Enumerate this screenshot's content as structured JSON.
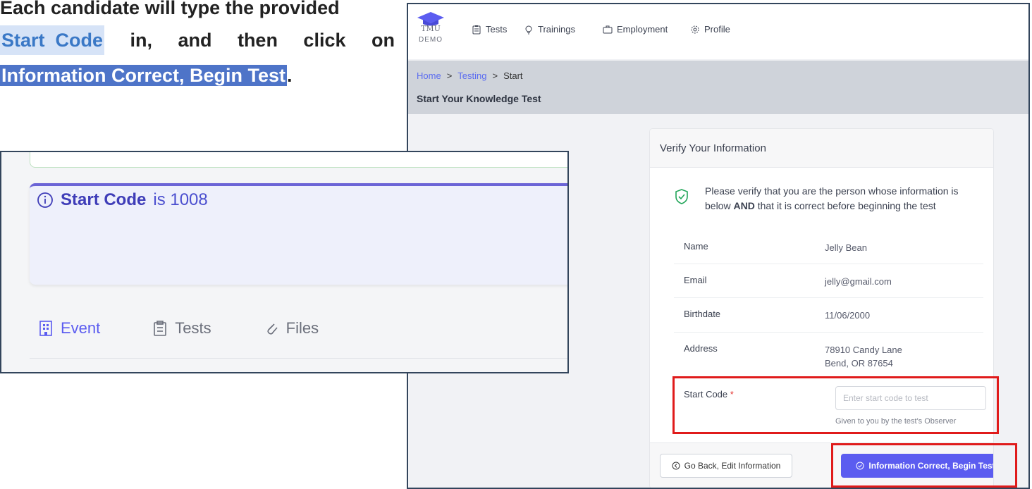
{
  "instruction": {
    "line1": "Each candidate will type the provided",
    "line2_word1": "Start",
    "line2_word2": "Code",
    "line2_mid1": "in,",
    "line2_mid2": "and",
    "line2_mid3": "then",
    "line2_mid4": "click",
    "line2_end": "on",
    "line3_highlight": "Information Correct, Begin Test",
    "line3_end": "."
  },
  "app": {
    "logo": {
      "tmu": "TMU",
      "demo": "DEMO"
    },
    "nav": [
      {
        "label": "Tests",
        "icon": "clipboard-icon"
      },
      {
        "label": "Trainings",
        "icon": "lightbulb-icon"
      },
      {
        "label": "Employment",
        "icon": "briefcase-icon"
      },
      {
        "label": "Profile",
        "icon": "gear-icon"
      }
    ],
    "breadcrumb": {
      "home": "Home",
      "testing": "Testing",
      "start": "Start",
      "separator": ">"
    },
    "page_title": "Start Your Knowledge Test",
    "card": {
      "title": "Verify Your Information",
      "notice_pre": "Please verify that you are the person whose information is below ",
      "notice_bold": "AND",
      "notice_post": " that it is correct before beginning the test",
      "rows": [
        {
          "label": "Name",
          "value": "Jelly Bean"
        },
        {
          "label": "Email",
          "value": "jelly@gmail.com"
        },
        {
          "label": "Birthdate",
          "value": "11/06/2000"
        },
        {
          "label": "Address",
          "value_line1": "78910 Candy Lane",
          "value_line2": "Bend, OR 87654"
        }
      ],
      "start_code": {
        "label": "Start Code",
        "required_mark": "*",
        "placeholder": "Enter start code to test",
        "value": "",
        "help": "Given to you by the test's Observer"
      },
      "back_button": "Go Back, Edit Information",
      "submit_button": "Information Correct, Begin Test"
    }
  },
  "inset": {
    "start_code_label": "Start Code",
    "start_code_suffix": "is 1008",
    "tabs": [
      {
        "label": "Event",
        "icon": "building-icon"
      },
      {
        "label": "Tests",
        "icon": "clipboard-icon"
      },
      {
        "label": "Files",
        "icon": "paperclip-icon"
      }
    ]
  },
  "colors": {
    "accent": "#5b5cf0",
    "highlight_blue": "#4e74c8",
    "callout_red": "#e01b1b"
  }
}
